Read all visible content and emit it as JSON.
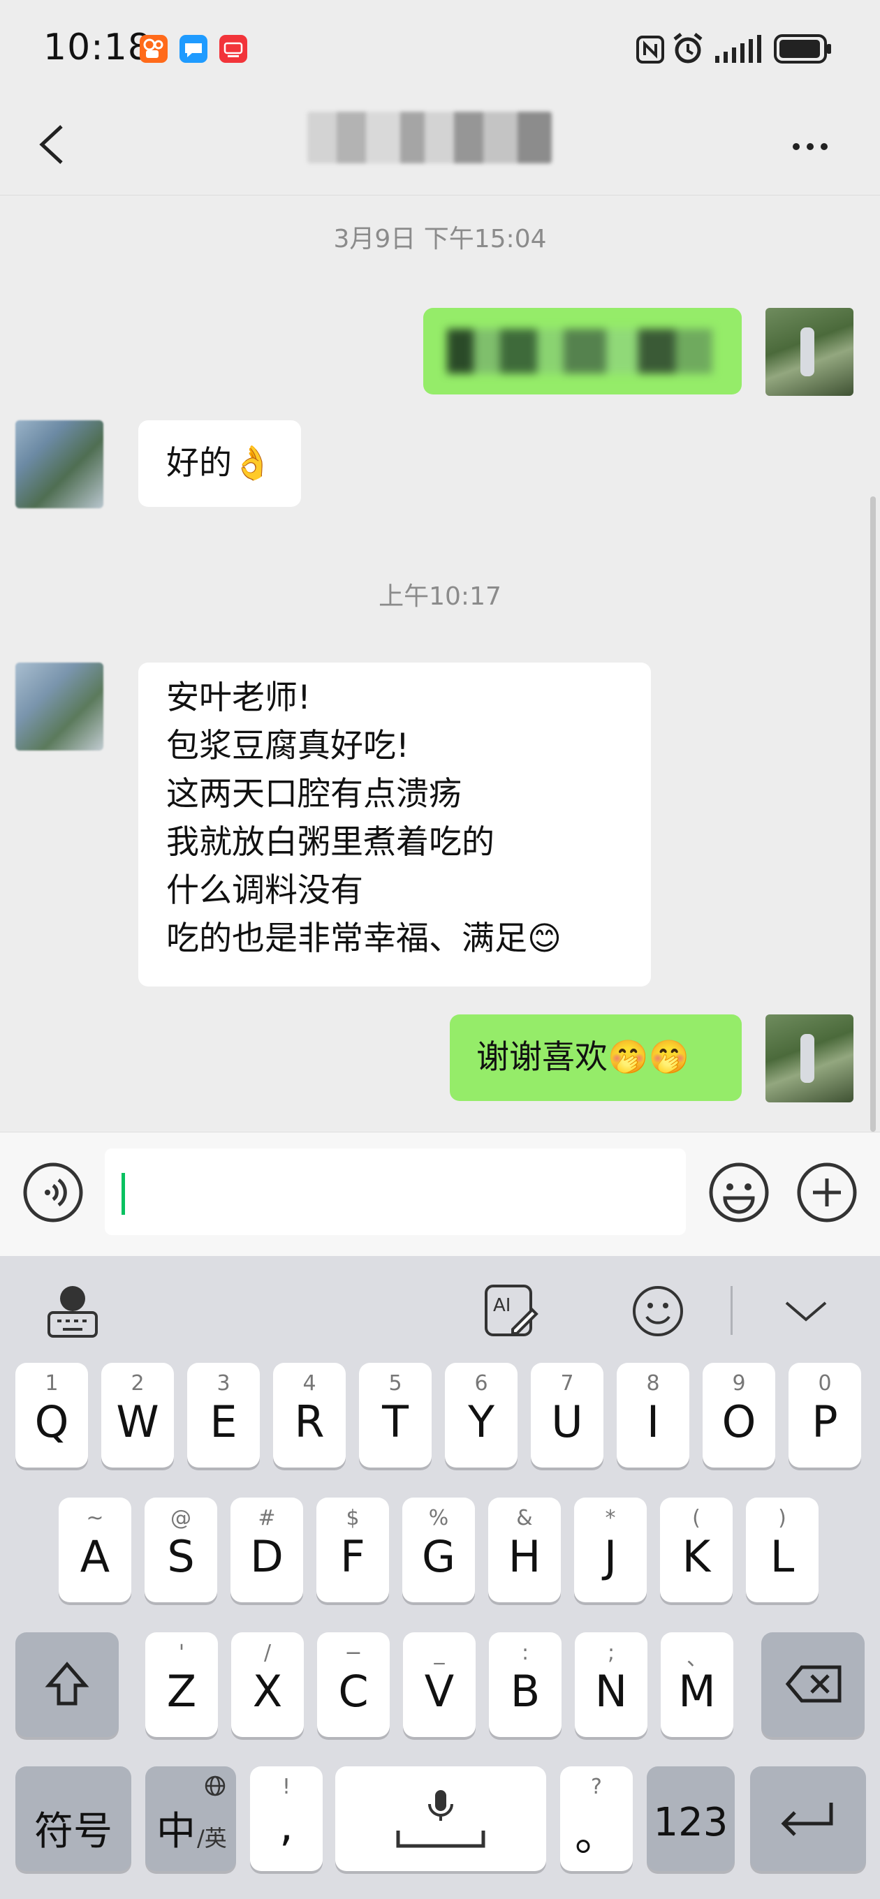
{
  "status_bar": {
    "time": "10:18",
    "icons": [
      "kuaishou-app-icon",
      "message-app-icon",
      "red-app-icon",
      "nfc-icon",
      "alarm-icon",
      "signal-icon",
      "battery-icon"
    ]
  },
  "header": {
    "title": "",
    "back_icon": "chevron-left-icon",
    "more_icon": "more-dots-icon"
  },
  "chat": {
    "timestamps": [
      "3月9日 下午15:04",
      "上午10:17"
    ],
    "messages": [
      {
        "side": "out",
        "text": ""
      },
      {
        "side": "in",
        "text": "好的👌"
      },
      {
        "side": "in",
        "lines": [
          "安叶老师!",
          "包浆豆腐真好吃!",
          "这两天口腔有点溃疡",
          "我就放白粥里煮着吃的",
          "什么调料没有",
          "吃的也是非常幸福、满足😊"
        ]
      },
      {
        "side": "out",
        "text": "谢谢喜欢🤭🤭"
      }
    ]
  },
  "input_bar": {
    "voice_icon": "voice-icon",
    "emoji_icon": "emoji-icon",
    "plus_icon": "plus-icon",
    "value": ""
  },
  "keyboard": {
    "toolbar": [
      "keyboard-settings-icon",
      "ai-write-icon",
      "emoji-keyboard-icon",
      "collapse-keyboard-icon"
    ],
    "row1": [
      [
        "1",
        "Q"
      ],
      [
        "2",
        "W"
      ],
      [
        "3",
        "E"
      ],
      [
        "4",
        "R"
      ],
      [
        "5",
        "T"
      ],
      [
        "6",
        "Y"
      ],
      [
        "7",
        "U"
      ],
      [
        "8",
        "I"
      ],
      [
        "9",
        "O"
      ],
      [
        "0",
        "P"
      ]
    ],
    "row2": [
      [
        "~",
        "A"
      ],
      [
        "@",
        "S"
      ],
      [
        "#",
        "D"
      ],
      [
        "$",
        "F"
      ],
      [
        "%",
        "G"
      ],
      [
        "&",
        "H"
      ],
      [
        "*",
        "J"
      ],
      [
        "(",
        "K"
      ],
      [
        ")",
        "L"
      ]
    ],
    "row3": [
      [
        "'",
        "Z"
      ],
      [
        "/",
        "X"
      ],
      [
        "−",
        "C"
      ],
      [
        "_",
        "V"
      ],
      [
        ":",
        "B"
      ],
      [
        ";",
        "N"
      ],
      [
        "、",
        "M"
      ]
    ],
    "bottom": {
      "symbols": "符号",
      "lang_main": "中",
      "lang_sub": "/英",
      "comma_hint": "!",
      "comma": ",",
      "period_hint": "?",
      "period": "。",
      "numbers": "123"
    }
  },
  "colors": {
    "bg": "#ededed",
    "bubble_out": "#95ec69",
    "bubble_in": "#ffffff",
    "caret": "#07c160",
    "keyboard_bg": "#dcdde2",
    "func_key": "#aeb3bc"
  }
}
